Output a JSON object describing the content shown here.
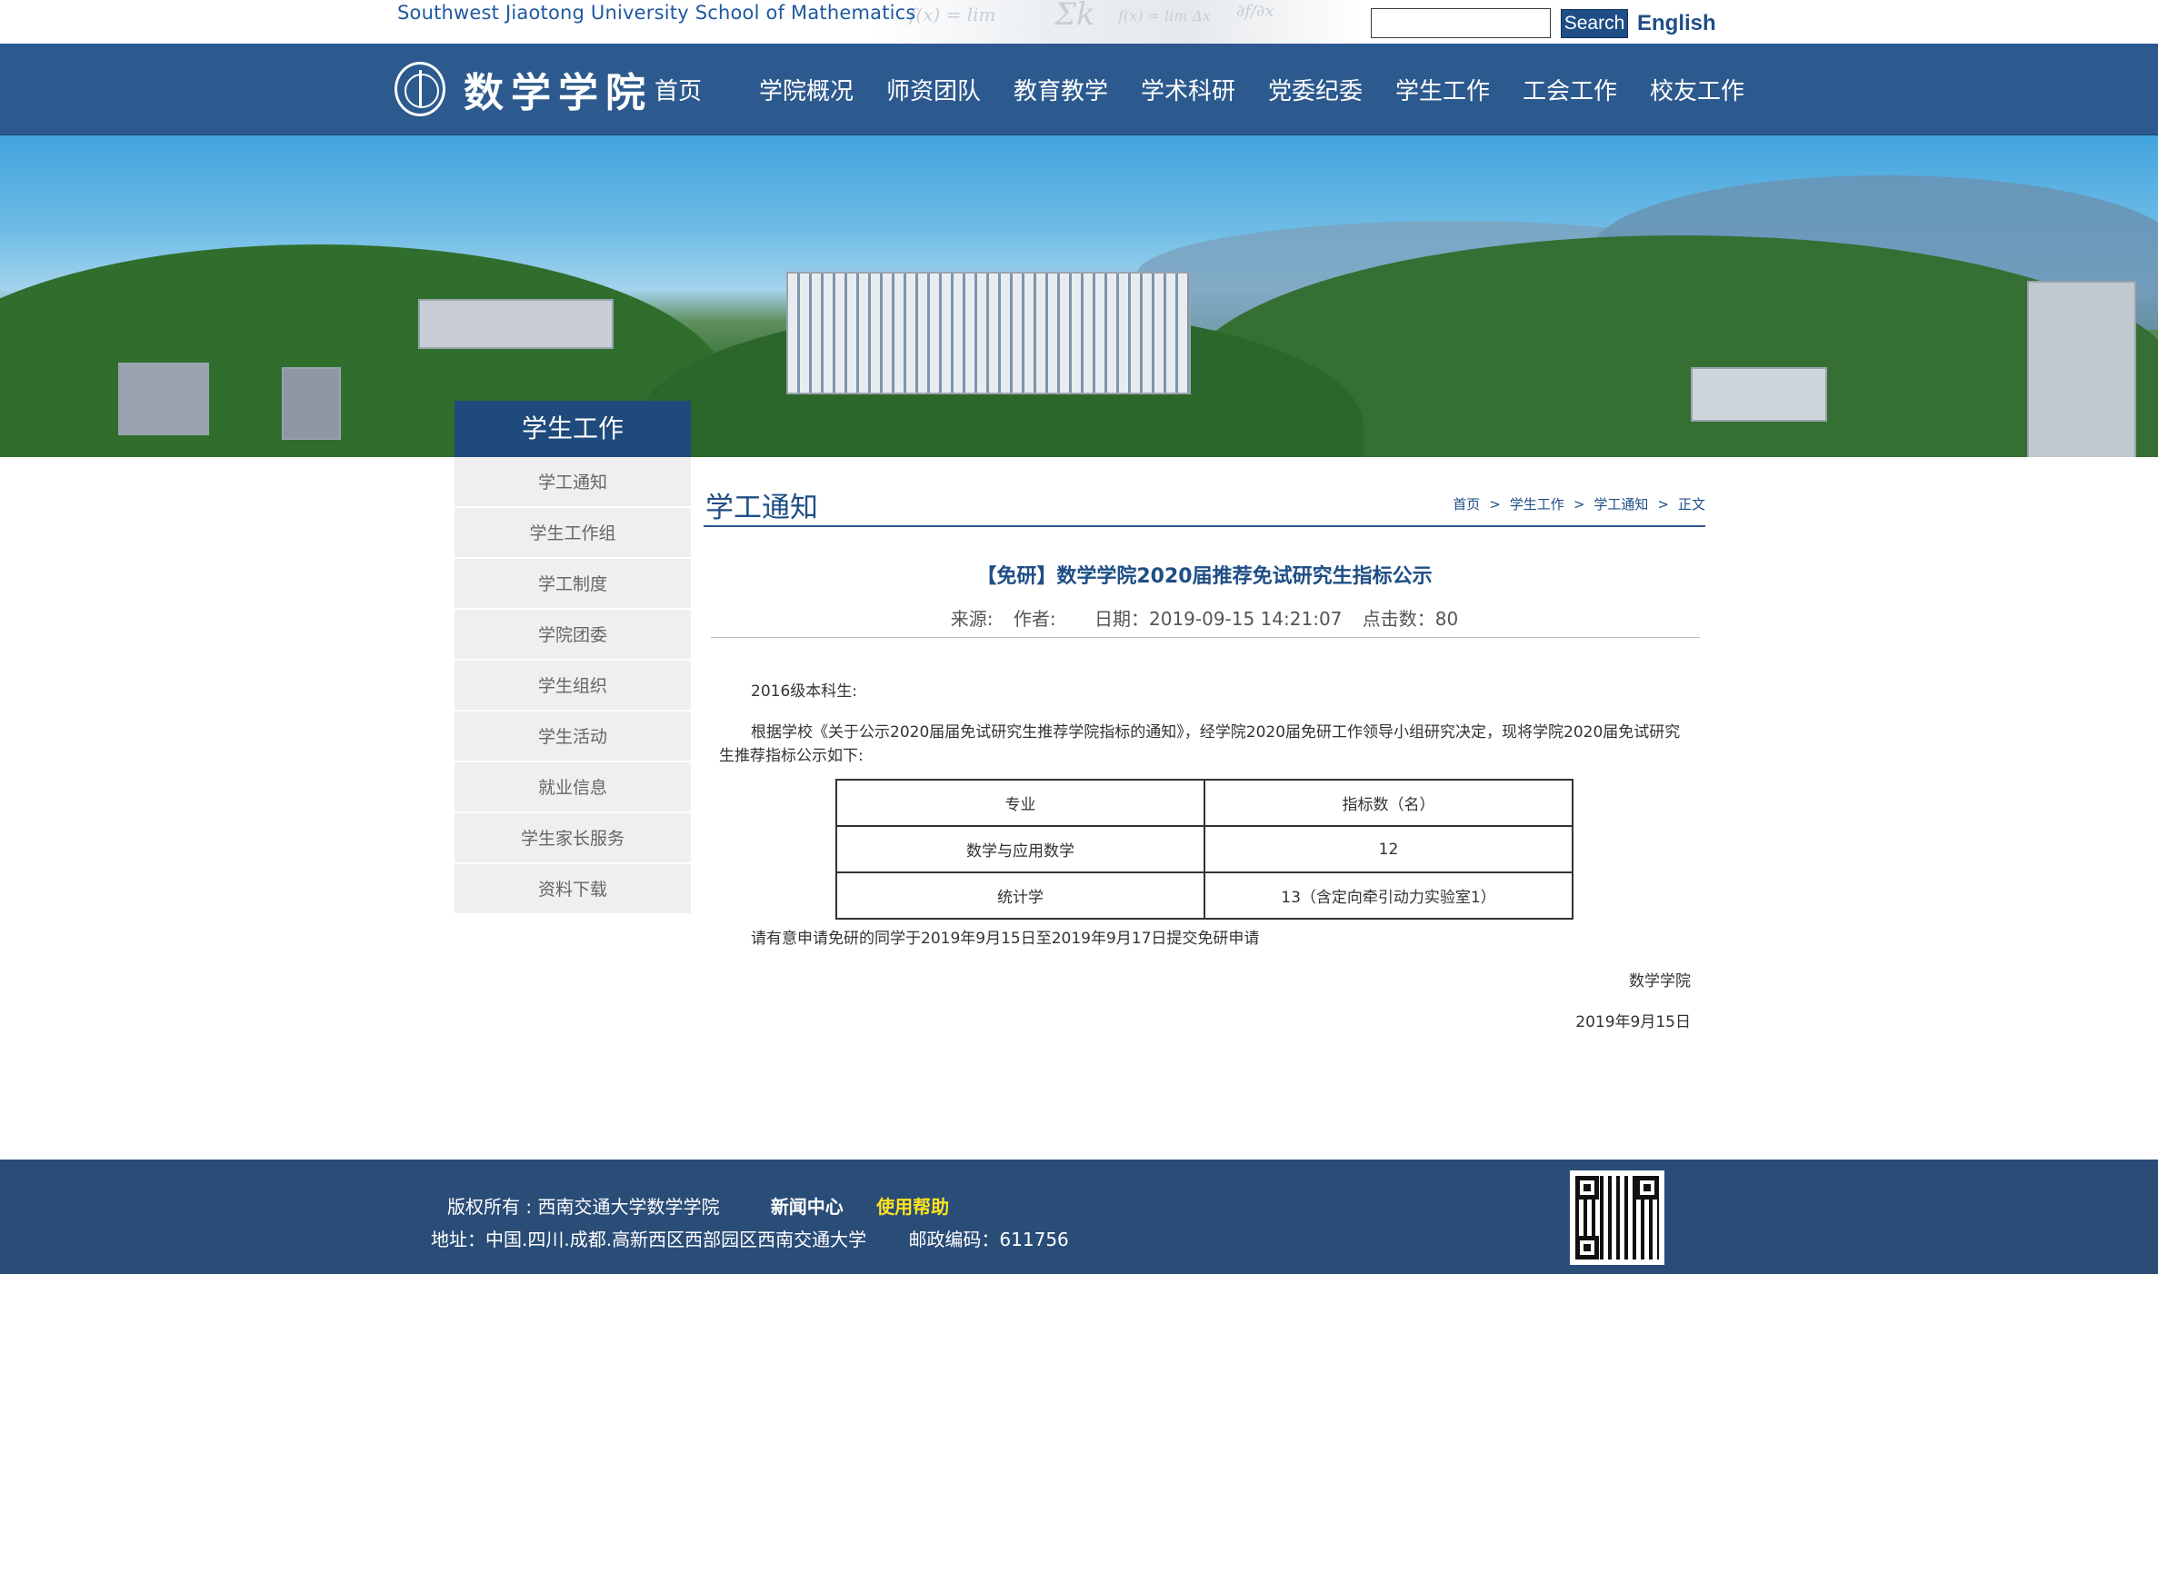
{
  "header": {
    "site_name_en": "Southwest Jiaotong University School of Mathematics",
    "search_placeholder": "",
    "search_button": "Search",
    "english_link": "English"
  },
  "nav": {
    "logo_text": "数学学院",
    "items": [
      "首页",
      "学院概况",
      "师资团队",
      "教育教学",
      "学术科研",
      "党委纪委",
      "学生工作",
      "工会工作",
      "校友工作"
    ]
  },
  "sidebar": {
    "title": "学生工作",
    "items": [
      "学工通知",
      "学生工作组",
      "学工制度",
      "学院团委",
      "学生组织",
      "学生活动",
      "就业信息",
      "学生家长服务",
      "资料下载"
    ]
  },
  "content": {
    "heading": "学工通知",
    "breadcrumb": [
      "首页",
      "学生工作",
      "学工通知",
      "正文"
    ],
    "breadcrumb_sep": ">",
    "article": {
      "title": "【免研】数学学院2020届推荐免试研究生指标公示",
      "meta": {
        "source": "来源:",
        "author": "作者:",
        "date": "日期：2019-09-15 14:21:07",
        "clicks": "点击数：80"
      },
      "greeting": "2016级本科生:",
      "paragraph": "根据学校《关于公示2020届届免试研究生推荐学院指标的通知》，经学院2020届免研工作领导小组研究决定，现将学院2020届免试研究生推荐指标公示如下:",
      "table": {
        "headers": [
          "专业",
          "指标数（名）"
        ],
        "rows": [
          [
            "数学与应用数学",
            "12"
          ],
          [
            "统计学",
            "13（含定向牵引动力实验室1）"
          ]
        ]
      },
      "notice": "请有意申请免研的同学于2019年9月15日至2019年9月17日提交免研申请",
      "signature": "数学学院",
      "sign_date": "2019年9月15日"
    }
  },
  "footer": {
    "copyright": "版权所有 : 西南交通大学数学学院",
    "news_link": "新闻中心",
    "help_link": "使用帮助",
    "address": "地址：中国.四川.成都.高新西区西部园区西南交通大学",
    "zip": "邮政编码：611756"
  },
  "colors": {
    "nav_bg": "#2d5a8e",
    "section_title_bg": "#1e4a7c",
    "footer_bg": "#2a4d78",
    "accent_text": "#1f4e86",
    "help_link": "#ffe21e"
  }
}
